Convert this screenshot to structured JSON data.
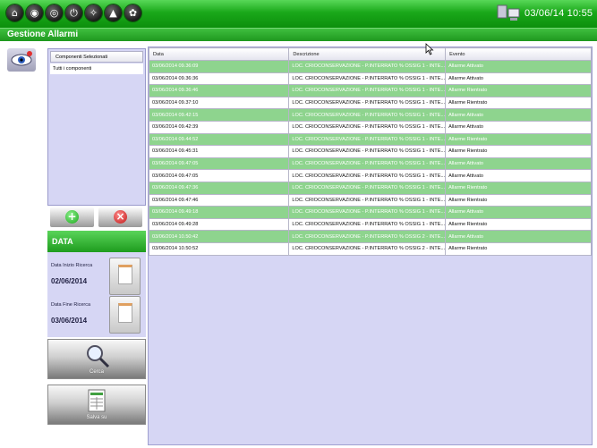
{
  "app": {
    "title": "Gestione Allarmi",
    "datetime": "03/06/14 10:55"
  },
  "toolbar": {
    "icons": [
      "home-icon",
      "globe-icon",
      "alarm-icon",
      "power-icon",
      "compass-icon",
      "mortarboard-icon",
      "network-icon"
    ]
  },
  "filter": {
    "header": "Componenti Selezionati",
    "items": [
      "Tutti i componenti"
    ],
    "add_icon": "plus-icon",
    "remove_icon": "x-icon"
  },
  "dates": {
    "section_title": "DATA",
    "start_label": "Data Inizio Ricerca",
    "start_value": "02/06/2014",
    "end_label": "Data Fine Ricerca",
    "end_value": "03/06/2014"
  },
  "actions": {
    "search_label": "Cerca",
    "export_label": "Salva su"
  },
  "table": {
    "headers": [
      "Data",
      "Descrizione",
      "Evento"
    ],
    "rows": [
      {
        "date": "03/06/2014 09.36:09",
        "desc": "LOC. CRIOCONSERVAZIONE - P.INTERRATO % OSSIG 1 - INTE...",
        "event": "Allarme Attivato",
        "alarm": true
      },
      {
        "date": "03/06/2014 09.36:36",
        "desc": "LOC. CRIOCONSERVAZIONE - P.INTERRATO % OSSIG 1 - INTE...",
        "event": "Allarme Attivato",
        "alarm": false
      },
      {
        "date": "03/06/2014 09.36:46",
        "desc": "LOC. CRIOCONSERVAZIONE - P.INTERRATO % OSSIG 1 - INTE...",
        "event": "Allarme Rientrato",
        "alarm": true
      },
      {
        "date": "03/06/2014 09.37:10",
        "desc": "LOC. CRIOCONSERVAZIONE - P.INTERRATO % OSSIG 1 - INTE...",
        "event": "Allarme Rientrato",
        "alarm": false
      },
      {
        "date": "03/06/2014 09.42:15",
        "desc": "LOC. CRIOCONSERVAZIONE - P.INTERRATO % OSSIG 1 - INTE...",
        "event": "Allarme Attivato",
        "alarm": true
      },
      {
        "date": "03/06/2014 09.42:39",
        "desc": "LOC. CRIOCONSERVAZIONE - P.INTERRATO % OSSIG 1 - INTE...",
        "event": "Allarme Attivato",
        "alarm": false
      },
      {
        "date": "03/06/2014 09.44:52",
        "desc": "LOC. CRIOCONSERVAZIONE - P.INTERRATO % OSSIG 1 - INTE...",
        "event": "Allarme Rientrato",
        "alarm": true
      },
      {
        "date": "03/06/2014 09.45:31",
        "desc": "LOC. CRIOCONSERVAZIONE - P.INTERRATO % OSSIG 1 - INTE...",
        "event": "Allarme Rientrato",
        "alarm": false
      },
      {
        "date": "03/06/2014 09.47:05",
        "desc": "LOC. CRIOCONSERVAZIONE - P.INTERRATO % OSSIG 1 - INTE...",
        "event": "Allarme Attivato",
        "alarm": true
      },
      {
        "date": "03/06/2014 09.47:05",
        "desc": "LOC. CRIOCONSERVAZIONE - P.INTERRATO % OSSIG 1 - INTE...",
        "event": "Allarme Attivato",
        "alarm": false
      },
      {
        "date": "03/06/2014 09.47:36",
        "desc": "LOC. CRIOCONSERVAZIONE - P.INTERRATO % OSSIG 1 - INTE...",
        "event": "Allarme Rientrato",
        "alarm": true
      },
      {
        "date": "03/06/2014 09.47:46",
        "desc": "LOC. CRIOCONSERVAZIONE - P.INTERRATO % OSSIG 1 - INTE...",
        "event": "Allarme Rientrato",
        "alarm": false
      },
      {
        "date": "03/06/2014 09.49:18",
        "desc": "LOC. CRIOCONSERVAZIONE - P.INTERRATO % OSSIG 1 - INTE...",
        "event": "Allarme Attivato",
        "alarm": true
      },
      {
        "date": "03/06/2014 09.49:28",
        "desc": "LOC. CRIOCONSERVAZIONE - P.INTERRATO % OSSIG 1 - INTE...",
        "event": "Allarme Rientrato",
        "alarm": false
      },
      {
        "date": "03/06/2014 10.50:42",
        "desc": "LOC. CRIOCONSERVAZIONE - P.INTERRATO % OSSIG 2 - INTE...",
        "event": "Allarme Attivato",
        "alarm": true
      },
      {
        "date": "03/06/2014 10.50:52",
        "desc": "LOC. CRIOCONSERVAZIONE - P.INTERRATO % OSSIG 2 - INTE...",
        "event": "Allarme Rientrato",
        "alarm": false
      }
    ]
  },
  "colors": {
    "brand_green": "#1aa81a",
    "alarm_row": "#8ed48e",
    "panel_lilac": "#d6d6f4"
  }
}
